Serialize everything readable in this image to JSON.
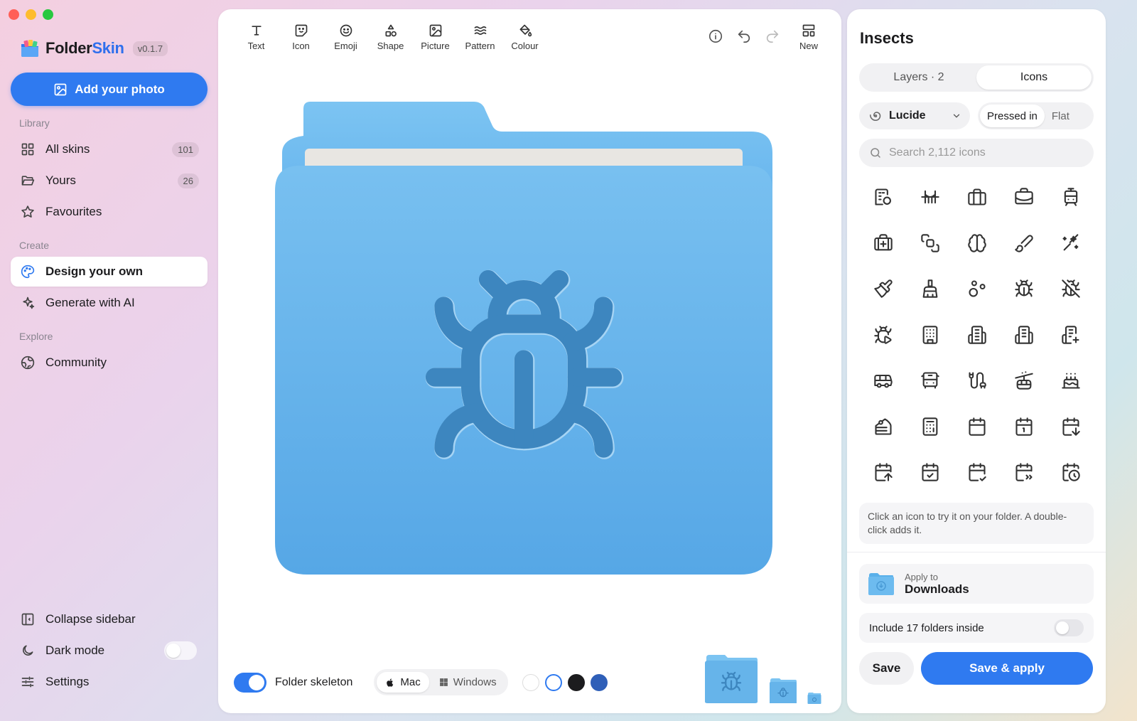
{
  "brand": {
    "name_part1": "Folder",
    "name_part2": "Skin",
    "version": "v0.1.7"
  },
  "sidebar": {
    "add_photo": "Add your photo",
    "library_label": "Library",
    "all_skins": {
      "label": "All skins",
      "count": "101"
    },
    "yours": {
      "label": "Yours",
      "count": "26"
    },
    "favourites": {
      "label": "Favourites"
    },
    "create_label": "Create",
    "design_own": {
      "label": "Design your own"
    },
    "generate_ai": {
      "label": "Generate with AI"
    },
    "explore_label": "Explore",
    "community": {
      "label": "Community"
    },
    "collapse": {
      "label": "Collapse sidebar"
    },
    "dark_mode": {
      "label": "Dark mode",
      "enabled": false
    },
    "settings": {
      "label": "Settings"
    }
  },
  "toolbar": {
    "tools": [
      "Text",
      "Icon",
      "Emoji",
      "Shape",
      "Picture",
      "Pattern",
      "Colour"
    ],
    "new_label": "New"
  },
  "canvas": {
    "folder_color": "#66b4ea",
    "glyph": "bug-icon",
    "skeleton_label": "Folder skeleton",
    "skeleton_enabled": true,
    "os_options": [
      "Mac",
      "Windows"
    ],
    "os_selected": "Mac",
    "swatches": [
      "#ffffff",
      "#ffffff",
      "#1c1c1e",
      "#2f5fb8"
    ]
  },
  "panel": {
    "title": "Insects",
    "tabs": [
      "Layers · 2",
      "Icons"
    ],
    "tab_selected": "Icons",
    "library": "Lucide",
    "styles": [
      "Pressed in",
      "Flat"
    ],
    "style_selected": "Pressed in",
    "search_placeholder": "Search 2,112 icons",
    "icons": [
      "building-2-icon",
      "bridge-icon",
      "briefcase-icon",
      "briefcase-business-icon",
      "tram-icon",
      "briefcase-medical-icon",
      "bring-to-front-icon",
      "brain-icon",
      "brush-icon",
      "sparkles-brush-icon",
      "paintbrush-icon",
      "brush-cleaning-icon",
      "bubbles-icon",
      "bug-icon",
      "bug-off-icon",
      "bug-play-icon",
      "building-icon",
      "building-2-icon",
      "building-2-icon",
      "building-plus-icon",
      "bus-icon",
      "bus-front-icon",
      "cable-icon",
      "cable-car-icon",
      "cake-icon",
      "cake-slice-icon",
      "calculator-icon",
      "calendar-icon",
      "calendar-1-icon",
      "calendar-arrow-down-icon",
      "calendar-arrow-up-icon",
      "calendar-check-icon",
      "calendar-check-2-icon",
      "calendar-cog-icon",
      "calendar-clock-icon"
    ],
    "hint": "Click an icon to try it on your folder. A double-click adds it.",
    "apply_small": "Apply to",
    "apply_target": "Downloads",
    "include_label": "Include 17 folders inside",
    "save": "Save",
    "save_apply": "Save & apply"
  }
}
